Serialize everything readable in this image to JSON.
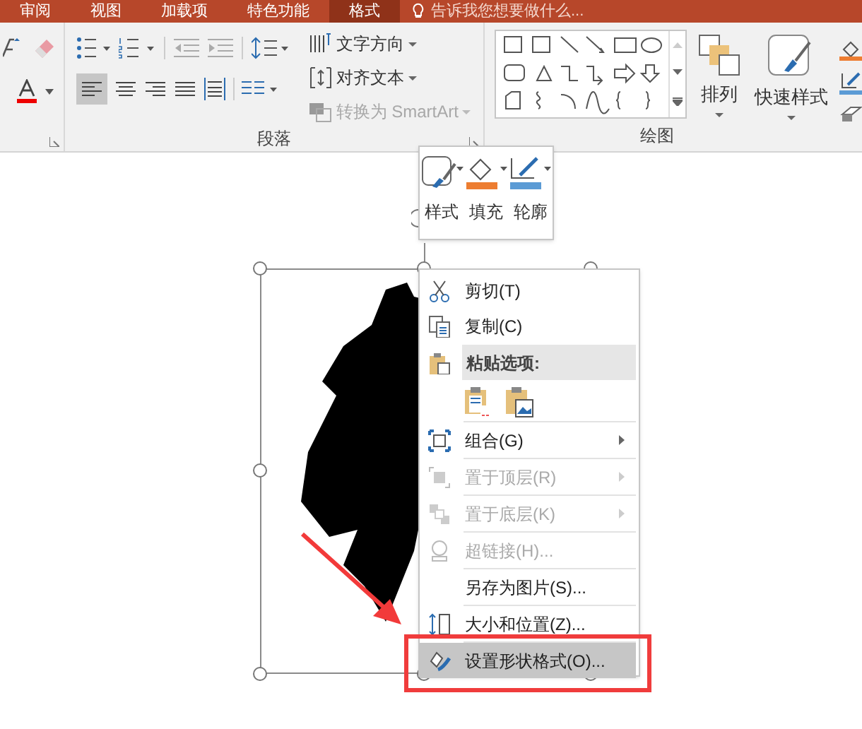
{
  "tabs": [
    {
      "label": "审阅",
      "selected": false
    },
    {
      "label": "视图",
      "selected": false
    },
    {
      "label": "加载项",
      "selected": false
    },
    {
      "label": "特色功能",
      "selected": false
    },
    {
      "label": "格式",
      "selected": true
    }
  ],
  "tell_me": {
    "placeholder": "告诉我您想要做什么..."
  },
  "ribbon": {
    "paragraph_group": {
      "label": "段落",
      "commands": [
        {
          "label": "文字方向",
          "disabled": false
        },
        {
          "label": "对齐文本",
          "disabled": false
        },
        {
          "label": "转换为 SmartArt",
          "disabled": true
        }
      ]
    },
    "drawing_group": {
      "label": "绘图",
      "buttons": [
        {
          "label": "排列"
        },
        {
          "label": "快速样式"
        }
      ]
    }
  },
  "mini_toolbar": {
    "buttons": [
      {
        "label": "样式"
      },
      {
        "label": "填充"
      },
      {
        "label": "轮廓"
      }
    ]
  },
  "context_menu": {
    "items": [
      {
        "kind": "clipboard",
        "label": "剪切(T)",
        "disabled": false,
        "submenu": false,
        "selected": false
      },
      {
        "kind": "clipboard",
        "label": "复制(C)",
        "disabled": false,
        "submenu": false,
        "selected": false
      },
      {
        "kind": "header",
        "label": "粘贴选项:"
      },
      {
        "kind": "paste-icons"
      },
      {
        "kind": "command",
        "label": "组合(G)",
        "disabled": false,
        "submenu": true,
        "selected": false
      },
      {
        "kind": "command",
        "label": "置于顶层(R)",
        "disabled": true,
        "submenu": true,
        "selected": false
      },
      {
        "kind": "command",
        "label": "置于底层(K)",
        "disabled": true,
        "submenu": true,
        "selected": false
      },
      {
        "kind": "command",
        "label": "超链接(H)...",
        "disabled": true,
        "submenu": false,
        "selected": false
      },
      {
        "kind": "command",
        "label": "另存为图片(S)...",
        "disabled": false,
        "submenu": false,
        "selected": false
      },
      {
        "kind": "command",
        "label": "大小和位置(Z)...",
        "disabled": false,
        "submenu": false,
        "selected": false
      },
      {
        "kind": "command",
        "label": "设置形状格式(O)...",
        "disabled": false,
        "submenu": false,
        "selected": true
      }
    ]
  }
}
